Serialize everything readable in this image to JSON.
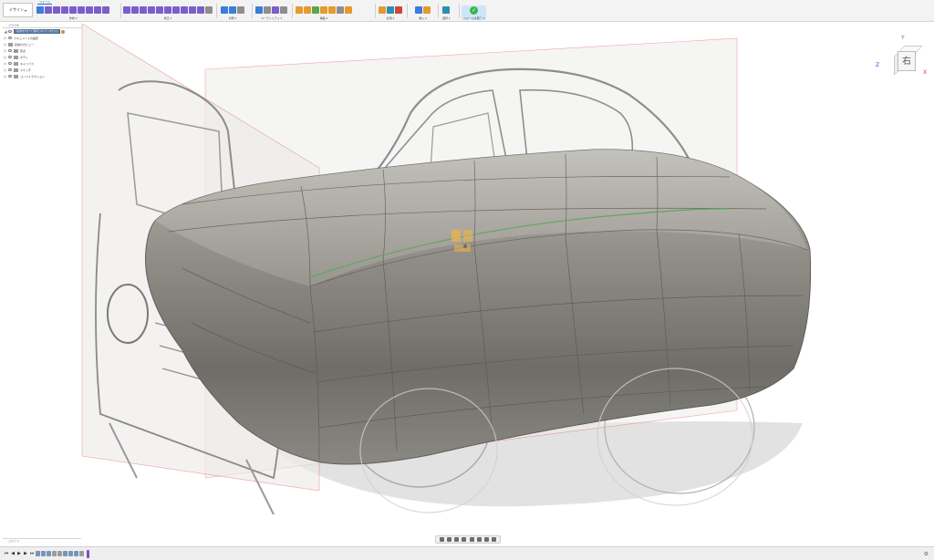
{
  "window": {
    "workspace_label": "デザイン",
    "active_tab": "フォーム"
  },
  "toolbar": {
    "groups": [
      {
        "label": "作成 ▾"
      },
      {
        "label": "修正 ▾"
      },
      {
        "label": "対称 ▾"
      },
      {
        "label": "ユーティリティ ▾"
      },
      {
        "label": "構築 ▾"
      },
      {
        "label": "計測 ▾"
      },
      {
        "label": "挿入 ▾"
      },
      {
        "label": "選択 ▾"
      },
      {
        "label": "フォームを終了 ▾"
      }
    ]
  },
  "browser": {
    "title": "ブラウザ",
    "root": "(名前を付けて保存されていません)",
    "items": [
      {
        "label": "ドキュメントの設定"
      },
      {
        "label": "名前付きビュー"
      },
      {
        "label": "原点"
      },
      {
        "label": "ボディ"
      },
      {
        "label": "キャンバス"
      },
      {
        "label": "スケッチ"
      },
      {
        "label": "コンストラクション"
      }
    ]
  },
  "viewcube": {
    "face_label": "右",
    "axis_x": "X",
    "axis_y": "Y",
    "axis_z": "Z"
  },
  "comments": {
    "label": "コメント"
  },
  "timeline": {
    "controls": [
      "⏮",
      "◀",
      "▶",
      "▶",
      "⏭"
    ]
  },
  "colors": {
    "accent": "#2a6fc9",
    "body": "#8b8a84",
    "plane_edge": "#e06060",
    "finish_green": "#3cb54a",
    "timeline_marker": "#7b4fc7"
  }
}
